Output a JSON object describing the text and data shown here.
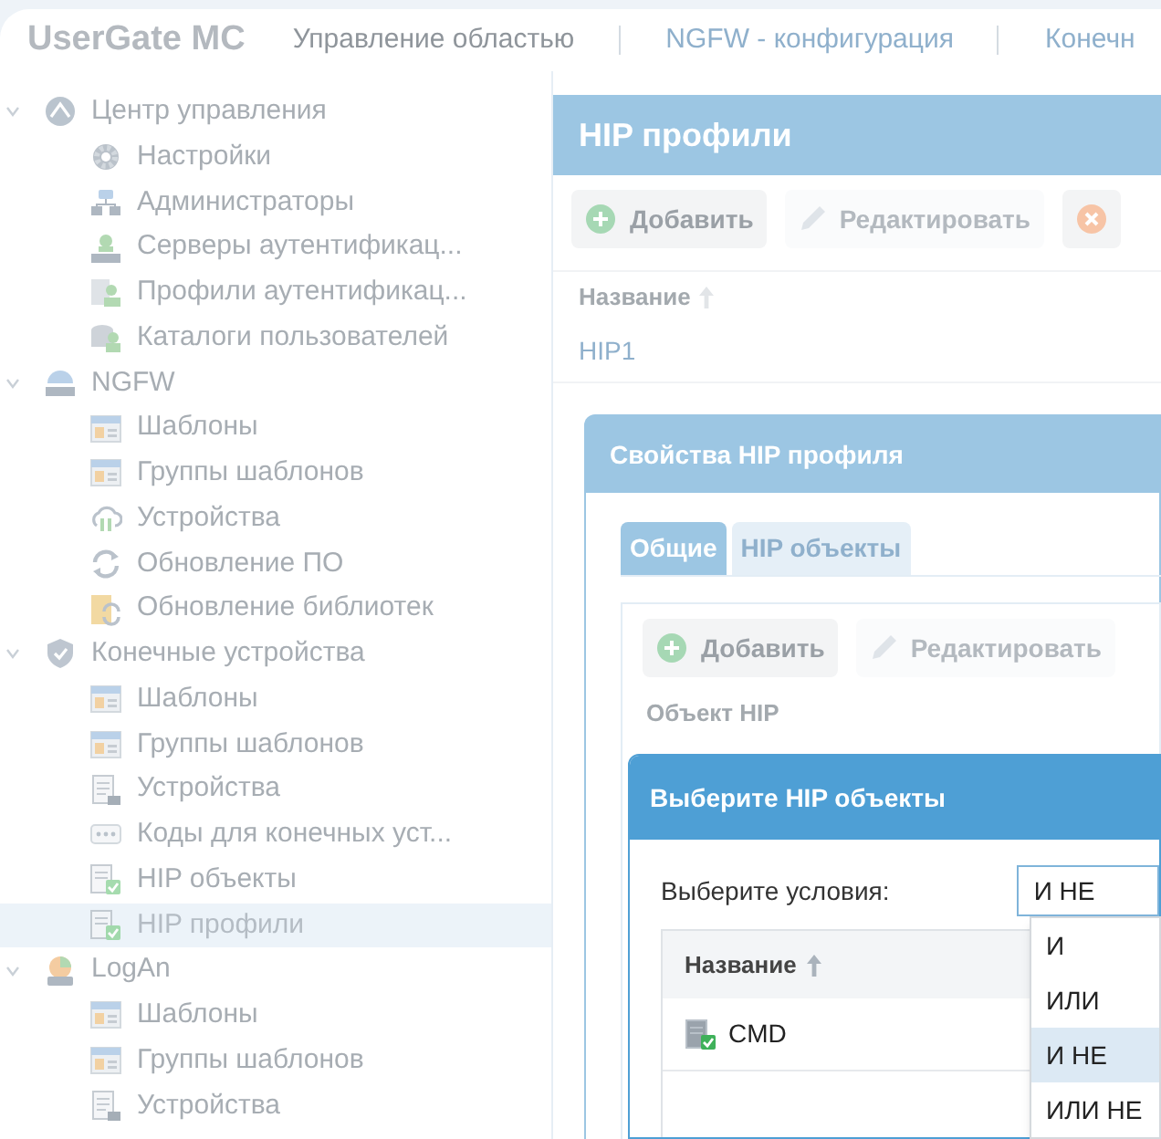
{
  "header": {
    "logo": "UserGate MC",
    "nav": [
      {
        "label": "Управление областью",
        "selected": true
      },
      {
        "label": "NGFW - конфигурация",
        "selected": false
      },
      {
        "label": "Конечн",
        "selected": false
      }
    ]
  },
  "sidebar": {
    "items": [
      {
        "label": "Центр управления",
        "expanded": true,
        "selected": false,
        "children": [
          {
            "label": "Настройки",
            "selected": false
          },
          {
            "label": "Администраторы",
            "selected": false
          },
          {
            "label": "Серверы аутентификац...",
            "selected": false
          },
          {
            "label": "Профили аутентификац...",
            "selected": false
          },
          {
            "label": "Каталоги пользователей",
            "selected": false
          }
        ]
      },
      {
        "label": "NGFW",
        "expanded": true,
        "selected": false,
        "children": [
          {
            "label": "Шаблоны",
            "selected": false
          },
          {
            "label": "Группы шаблонов",
            "selected": false
          },
          {
            "label": "Устройства",
            "selected": false
          },
          {
            "label": "Обновление ПО",
            "selected": false
          },
          {
            "label": "Обновление библиотек",
            "selected": false
          }
        ]
      },
      {
        "label": "Конечные устройства",
        "expanded": true,
        "selected": false,
        "children": [
          {
            "label": "Шаблоны",
            "selected": false
          },
          {
            "label": "Группы шаблонов",
            "selected": false
          },
          {
            "label": "Устройства",
            "selected": false
          },
          {
            "label": "Коды для конечных уст...",
            "selected": false
          },
          {
            "label": "HIP объекты",
            "selected": false
          },
          {
            "label": "HIP профили",
            "selected": true
          }
        ]
      },
      {
        "label": "LogAn",
        "expanded": true,
        "selected": false,
        "children": [
          {
            "label": "Шаблоны",
            "selected": false
          },
          {
            "label": "Группы шаблонов",
            "selected": false
          },
          {
            "label": "Устройства",
            "selected": false
          }
        ]
      }
    ]
  },
  "main": {
    "title": "HIP профили",
    "toolbar": [
      {
        "kind": "add",
        "label": "Добавить",
        "disabled": false
      },
      {
        "kind": "edit",
        "label": "Редактировать",
        "disabled": true
      },
      {
        "kind": "delete"
      }
    ],
    "table": {
      "columns": [
        "Название"
      ],
      "rows": [
        [
          "HIP1"
        ]
      ]
    }
  },
  "properties_dialog": {
    "title": "Свойства HIP профиля",
    "tabs": [
      {
        "label": "Общие",
        "selected": true
      },
      {
        "label": "HIP объекты",
        "selected": false
      }
    ],
    "toolbar": [
      {
        "kind": "add",
        "label": "Добавить",
        "disabled": false
      },
      {
        "kind": "edit",
        "label": "Редактировать",
        "disabled": true
      }
    ],
    "table": {
      "columns": [
        "Объект HIP"
      ]
    }
  },
  "select_dialog": {
    "title": "Выберите HIP объекты",
    "condition_label": "Выберите условия:",
    "condition_value": "И НЕ",
    "table": {
      "columns": [
        "Название"
      ],
      "rows": [
        [
          "CMD"
        ]
      ]
    },
    "dropdown": [
      {
        "label": "И",
        "selected": false
      },
      {
        "label": "ИЛИ",
        "selected": false
      },
      {
        "label": "И НЕ",
        "selected": true
      },
      {
        "label": "ИЛИ НЕ",
        "selected": false
      }
    ]
  }
}
